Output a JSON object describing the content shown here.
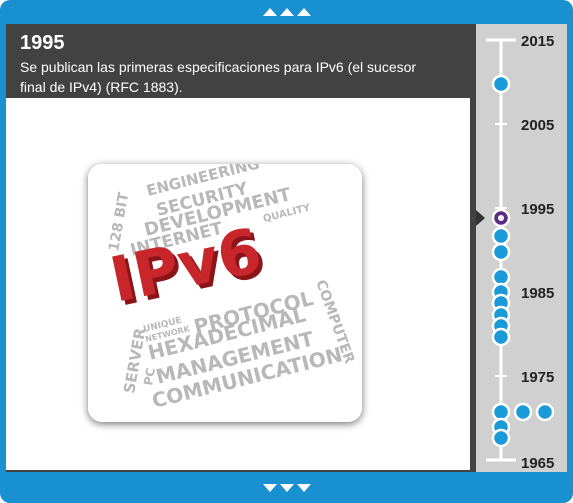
{
  "navigation": {
    "up_label": "",
    "down_label": ""
  },
  "event": {
    "year": "1995",
    "description": "Se publican las primeras especificaciones para IPv6 (el sucesor final de IPv4) (RFC 1883).",
    "description_line1": "Se publican las primeras especificaciones para IPv6 (el sucesor",
    "description_line2": "final de IPv4) (RFC 1883)."
  },
  "image": {
    "main_text": "IPv6",
    "words": [
      "ENGINEERING",
      "SECURITY",
      "DEVELOPMENT",
      "INTERNET",
      "QUALITY",
      "128 BIT",
      "PROTOCOL",
      "UNIQUE",
      "NETWORK",
      "HEXADECIMAL",
      "MANAGEMENT",
      "COMMUNICATION",
      "SERVER",
      "PC",
      "COMPUTER"
    ]
  },
  "timeline": {
    "labels": [
      "2015",
      "2005",
      "1995",
      "1985",
      "1975",
      "1965"
    ],
    "selected_year": "1995"
  },
  "colors": {
    "frame_blue": "#1990cf",
    "panel_gray": "#424242",
    "sidebar_gray": "#d0d0d0",
    "dot_blue": "#1a9ad8",
    "selected_purple": "#5a2d82",
    "ipv6_red": "#c8262b"
  }
}
